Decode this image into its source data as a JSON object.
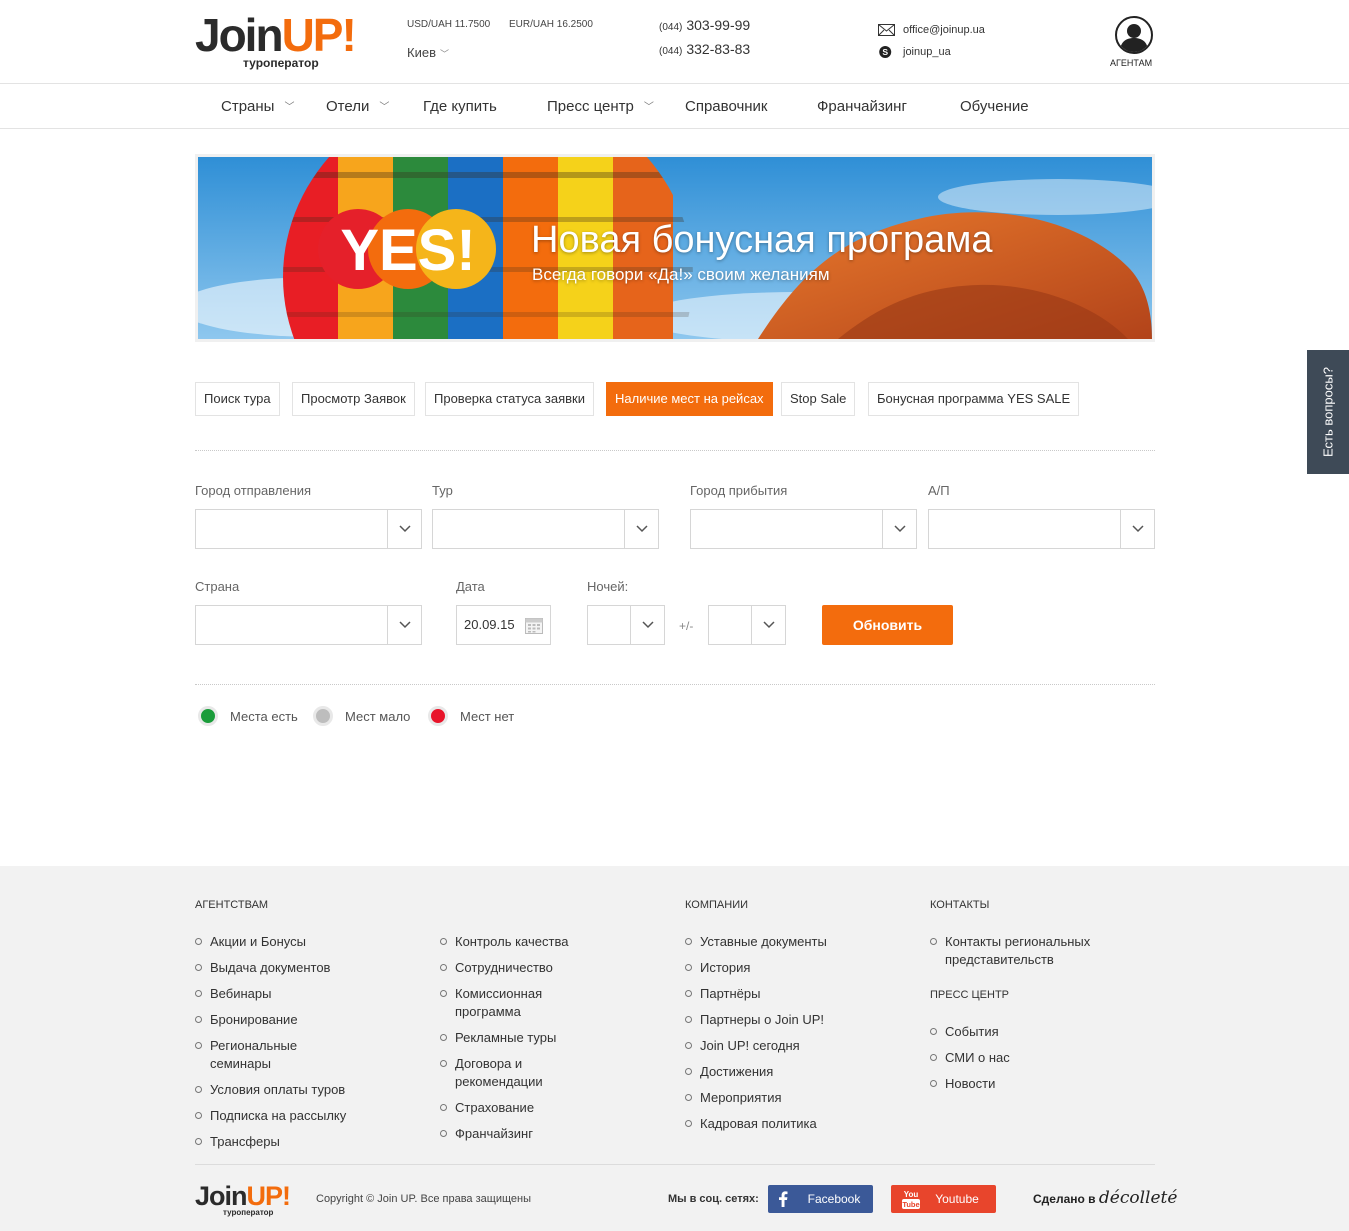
{
  "header": {
    "logo_word_1": "Join",
    "logo_word_2": "UP!",
    "logo_tagline": "туроператор",
    "rate_usd": "USD/UAH 11.7500",
    "rate_eur": "EUR/UAH 16.2500",
    "city": "Киев",
    "phone1_code": "(044)",
    "phone1": "303-99-99",
    "phone2_code": "(044)",
    "phone2": "332-83-83",
    "email": "office@joinup.ua",
    "skype": "joinup_ua",
    "agent_label": "АГЕНТАМ",
    "accent_color": "#f36c0d"
  },
  "nav": {
    "items": [
      {
        "label": "Страны",
        "dropdown": true
      },
      {
        "label": "Отели",
        "dropdown": true
      },
      {
        "label": "Где купить",
        "dropdown": false
      },
      {
        "label": "Пресс центр",
        "dropdown": true
      },
      {
        "label": "Справочник",
        "dropdown": false
      },
      {
        "label": "Франчайзинг",
        "dropdown": false
      },
      {
        "label": "Обучение",
        "dropdown": false
      }
    ]
  },
  "banner": {
    "logo_text": "YES!",
    "title": "Новая бонусная програма",
    "subtitle": "Всегда говори «Да!» своим желаниям"
  },
  "tabs": [
    {
      "label": "Поиск тура",
      "active": false
    },
    {
      "label": "Просмотр Заявок",
      "active": false
    },
    {
      "label": "Проверка статуса заявки",
      "active": false
    },
    {
      "label": "Наличие мест на рейсах",
      "active": true
    },
    {
      "label": "Stop Sale",
      "active": false
    },
    {
      "label": "Бонусная программа YES SALE",
      "active": false
    }
  ],
  "form": {
    "departure_label": "Город отправления",
    "tour_label": "Тур",
    "arrival_label": "Город прибытия",
    "airport_label": "А/П",
    "country_label": "Страна",
    "date_label": "Дата",
    "date_value": "20.09.15",
    "nights_label": "Ночей:",
    "plusminus": "+/-",
    "submit": "Обновить"
  },
  "legend": [
    {
      "label": "Места есть",
      "color": "#1a9c3a"
    },
    {
      "label": "Мест мало",
      "color": "#bdbdbd"
    },
    {
      "label": "Мест нет",
      "color": "#e8142a"
    }
  ],
  "side_question": "Есть вопросы?",
  "footer": {
    "col1": {
      "heading": "АГЕНТСТВАМ",
      "items": [
        "Акции и Бонусы",
        "Выдача документов",
        "Вебинары",
        "Бронирование",
        "Региональные семинары",
        "Условия оплаты туров",
        "Подписка на рассылку",
        "Трансферы"
      ]
    },
    "col2": {
      "items": [
        "Контроль качества",
        "Сотрудничество",
        "Комиссионная программа",
        "Рекламные туры",
        "Договора и рекомендации",
        "Страхование",
        "Франчайзинг"
      ]
    },
    "col3": {
      "heading": "КОМПАНИИ",
      "items": [
        "Уставные документы",
        "История",
        "Партнёры",
        "Партнеры о Join UP!",
        "Join UP! сегодня",
        "Достижения",
        "Мероприятия",
        "Кадровая политика"
      ]
    },
    "col4": {
      "heading": "КОНТАКТЫ",
      "items": [
        "Контакты региональных представительств"
      ],
      "heading2": "ПРЕСС ЦЕНТР",
      "items2": [
        "События",
        "СМИ о нас",
        "Новости"
      ]
    },
    "logo_word_1": "Join",
    "logo_word_2": "UP!",
    "logo_tagline": "туроператор",
    "copyright": "Copyright © Join UP. Все права защищены",
    "social_label": "Мы в соц. сетях:",
    "facebook": "Facebook",
    "youtube": "Youtube",
    "youtube_badge_1": "You",
    "youtube_badge_2": "Tube",
    "made_by": "Сделано в",
    "made_brand": "décolleté",
    "facebook_color": "#3b5998",
    "youtube_color": "#e8452c"
  }
}
